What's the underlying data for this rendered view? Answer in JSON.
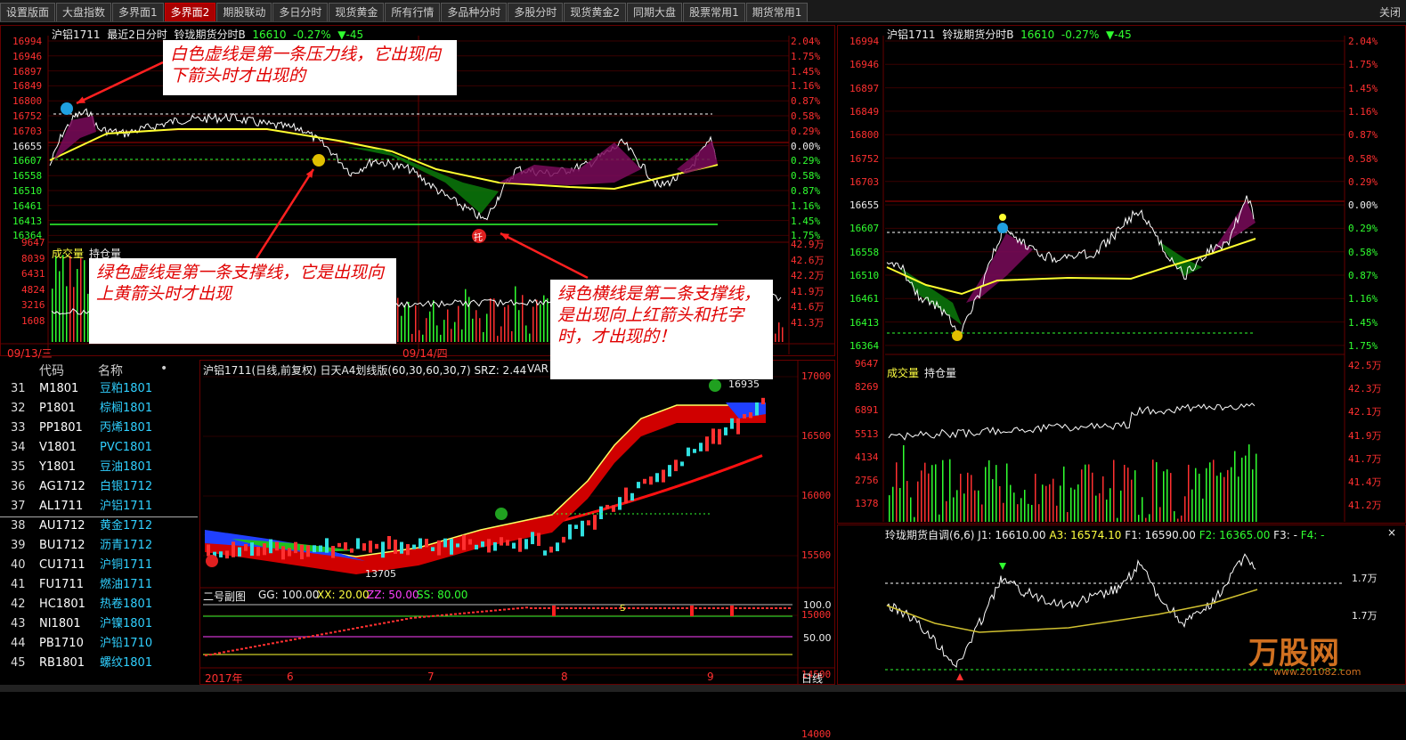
{
  "tabs": [
    "设置版面",
    "大盘指数",
    "多界面1",
    "多界面2",
    "期股联动",
    "多日分时",
    "现货黄金",
    "所有行情",
    "多品种分时",
    "多股分时",
    "现货黄金2",
    "同期大盘",
    "股票常用1",
    "期货常用1"
  ],
  "active_tab": 3,
  "close_label": "关闭",
  "tl": {
    "hdr_name": "沪铝1711",
    "hdr_mode": "最近2日分时",
    "hdr_source": "铃珑期货分时B",
    "hdr_price": "16610",
    "hdr_change": "-0.27%",
    "hdr_delta": "▼-45",
    "left_axis": [
      "16994",
      "16946",
      "16897",
      "16849",
      "16800",
      "16752",
      "16703",
      "16655",
      "16607",
      "16558",
      "16510",
      "16461",
      "16413",
      "16364"
    ],
    "right_axis": [
      "2.04%",
      "1.75%",
      "1.45%",
      "1.16%",
      "0.87%",
      "0.58%",
      "0.29%",
      "0.00%",
      "0.29%",
      "0.58%",
      "0.87%",
      "1.16%",
      "1.45%",
      "1.75%"
    ],
    "vol_label": "成交量",
    "oi_label": "持仓量",
    "vol_axis": [
      "9647",
      "8039",
      "6431",
      "4824",
      "3216",
      "1608"
    ],
    "oi_axis": [
      "42.9万",
      "42.6万",
      "42.2万",
      "41.9万",
      "41.6万",
      "41.3万"
    ],
    "date1": "09/13/三",
    "date2": "09/14/四",
    "tuo": "托"
  },
  "callouts": {
    "c1": "白色虚线是第一条压力线，它出现向下箭头时才出现的",
    "c2": "绿色虚线是第一条支撑线，它是出现向上黄箭头时才出现",
    "c3": "绿色横线是第二条支撑线，是出现向上红箭头和托字时，才出现的！"
  },
  "list": {
    "col_code": "代码",
    "col_name": "名称",
    "dot": "•",
    "rows": [
      {
        "n": "31",
        "c": "M1801",
        "nm": "豆粕1801"
      },
      {
        "n": "32",
        "c": "P1801",
        "nm": "棕榈1801"
      },
      {
        "n": "33",
        "c": "PP1801",
        "nm": "丙烯1801"
      },
      {
        "n": "34",
        "c": "V1801",
        "nm": "PVC1801"
      },
      {
        "n": "35",
        "c": "Y1801",
        "nm": "豆油1801"
      },
      {
        "n": "36",
        "c": "AG1712",
        "nm": "白银1712"
      },
      {
        "n": "37",
        "c": "AL1711",
        "nm": "沪铝1711"
      },
      {
        "n": "38",
        "c": "AU1712",
        "nm": "黄金1712"
      },
      {
        "n": "39",
        "c": "BU1712",
        "nm": "沥青1712"
      },
      {
        "n": "40",
        "c": "CU1711",
        "nm": "沪铜1711"
      },
      {
        "n": "41",
        "c": "FU1711",
        "nm": "燃油1711"
      },
      {
        "n": "42",
        "c": "HC1801",
        "nm": "热卷1801"
      },
      {
        "n": "43",
        "c": "NI1801",
        "nm": "沪镍1801"
      },
      {
        "n": "44",
        "c": "PB1710",
        "nm": "沪铅1710"
      },
      {
        "n": "45",
        "c": "RB1801",
        "nm": "螺纹1801"
      }
    ]
  },
  "kline": {
    "hdr": "沪铝1711(日线,前复权) 日天A4划线版(60,30,60,30,7) SRZ: 2.44",
    "hdr_var": "VAR",
    "axis": [
      "17000",
      "16500",
      "16000",
      "15500",
      "15000",
      "14500",
      "14000"
    ],
    "high_label": "16935",
    "low_label": "13705",
    "tuo": "托",
    "sub_title": "二号副图",
    "gg": "GG: 100.00",
    "xx": "XX: 20.00",
    "zz": "ZZ: 50.00",
    "ss": "SS: 80.00",
    "sub_axis": [
      "100.0",
      "50.00"
    ],
    "x_labels": [
      "2017年",
      "6",
      "7",
      "8",
      "9"
    ],
    "period": "日线",
    "s_mark": "S"
  },
  "tr": {
    "hdr_name": "沪铝1711",
    "hdr_source": "铃珑期货分时B",
    "hdr_price": "16610",
    "hdr_change": "-0.27%",
    "hdr_delta": "▼-45",
    "left_axis": [
      "16994",
      "16946",
      "16897",
      "16849",
      "16800",
      "16752",
      "16703",
      "16655",
      "16607",
      "16558",
      "16510",
      "16461",
      "16413",
      "16364"
    ],
    "right_axis": [
      "2.04%",
      "1.75%",
      "1.45%",
      "1.16%",
      "0.87%",
      "0.58%",
      "0.29%",
      "0.00%",
      "0.29%",
      "0.58%",
      "0.87%",
      "1.16%",
      "1.45%",
      "1.75%"
    ],
    "vol_axis": [
      "9647",
      "8269",
      "6891",
      "5513",
      "4134",
      "2756",
      "1378"
    ],
    "oi_axis": [
      "42.5万",
      "42.3万",
      "42.1万",
      "41.9万",
      "41.7万",
      "41.4万",
      "41.2万"
    ],
    "vol_label": "成交量",
    "oi_label": "持仓量"
  },
  "br": {
    "title": "玲珑期货自调(6,6)",
    "j1": "J1: 16610.00",
    "a3": "A3: 16574.10",
    "f1": "F1: 16590.00",
    "f2": "F2: 16365.00",
    "f3": "F3: -",
    "f4": "F4: -",
    "axis": [
      "1.7万",
      "1.7万"
    ],
    "close_x": "×"
  },
  "watermark": {
    "brand": "万股网",
    "url": "www.201082.com"
  }
}
